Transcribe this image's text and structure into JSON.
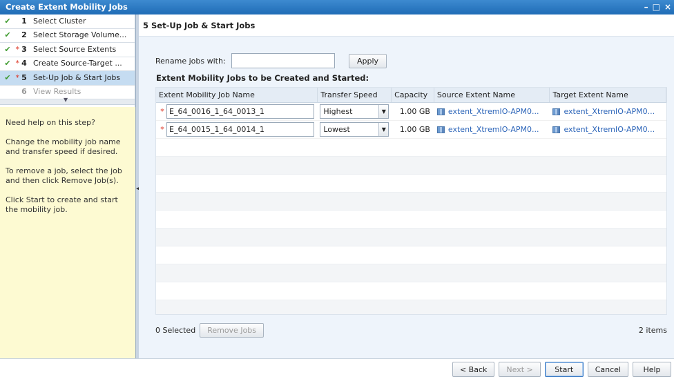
{
  "window": {
    "title": "Create Extent Mobility Jobs"
  },
  "steps": [
    {
      "num": "1",
      "label": "Select Cluster",
      "done": true,
      "required": false,
      "state": "normal"
    },
    {
      "num": "2",
      "label": "Select Storage Volume...",
      "done": true,
      "required": false,
      "state": "normal"
    },
    {
      "num": "3",
      "label": "Select Source Extents",
      "done": true,
      "required": true,
      "state": "normal"
    },
    {
      "num": "4",
      "label": "Create Source-Target ...",
      "done": true,
      "required": true,
      "state": "normal"
    },
    {
      "num": "5",
      "label": "Set-Up Job & Start Jobs",
      "done": true,
      "required": true,
      "state": "active"
    },
    {
      "num": "6",
      "label": "View Results",
      "done": false,
      "required": false,
      "state": "disabled"
    }
  ],
  "help": {
    "p1": "Need help on this step?",
    "p2": "Change the mobility job name and transfer speed if desired.",
    "p3": "To remove a job, select the job and then click Remove Job(s).",
    "p4": "Click Start to create and start the mobility job."
  },
  "page": {
    "heading": "5  Set-Up Job & Start Jobs",
    "rename_label": "Rename jobs with:",
    "rename_value": "",
    "apply_label": "Apply",
    "section_title": "Extent Mobility Jobs to be Created and Started:"
  },
  "grid": {
    "columns": [
      "Extent Mobility Job Name",
      "Transfer Speed",
      "Capacity",
      "Source Extent Name",
      "Target Extent Name"
    ],
    "rows": [
      {
        "name": "E_64_0016_1_64_0013_1",
        "speed": "Highest",
        "capacity": "1.00 GB",
        "source": "extent_XtremIO-APM0...",
        "target": "extent_XtremIO-APM0..."
      },
      {
        "name": "E_64_0015_1_64_0014_1",
        "speed": "Lowest",
        "capacity": "1.00 GB",
        "source": "extent_XtremIO-APM0...",
        "target": "extent_XtremIO-APM0..."
      }
    ]
  },
  "footer": {
    "selected": "0 Selected",
    "remove_label": "Remove Jobs",
    "item_count": "2 items"
  },
  "nav": {
    "back": "< Back",
    "next": "Next >",
    "start": "Start",
    "cancel": "Cancel",
    "help": "Help"
  },
  "colors": {
    "titlebar": "#2a77c2",
    "active_step": "#c5dcf1",
    "help_bg": "#fdfad2",
    "link": "#2a63b8"
  }
}
